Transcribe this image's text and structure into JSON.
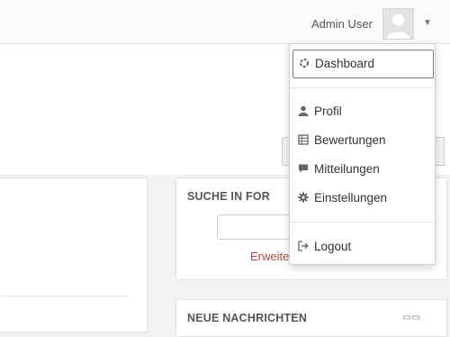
{
  "navbar": {
    "user_name": "Admin User",
    "avatar_icon": "user-avatar-icon",
    "caret_icon": "caret-down-icon"
  },
  "user_menu": {
    "items": [
      {
        "label": "Dashboard",
        "icon": "dashboard-icon"
      },
      {
        "label": "Profil",
        "icon": "user-icon"
      },
      {
        "label": "Bewertungen",
        "icon": "grades-table-icon"
      },
      {
        "label": "Mitteilungen",
        "icon": "message-icon"
      },
      {
        "label": "Einstellungen",
        "icon": "gear-icon"
      },
      {
        "label": "Logout",
        "icon": "logout-icon"
      }
    ]
  },
  "blocks": {
    "search_forums": {
      "title": "SUCHE IN FOR",
      "advanced_link": "Erweite"
    },
    "latest_news": {
      "title": "NEUE NACHRICHTEN"
    }
  },
  "colors": {
    "link": "#a84a3d",
    "border": "#e1e1e1",
    "icon": "#666666"
  }
}
